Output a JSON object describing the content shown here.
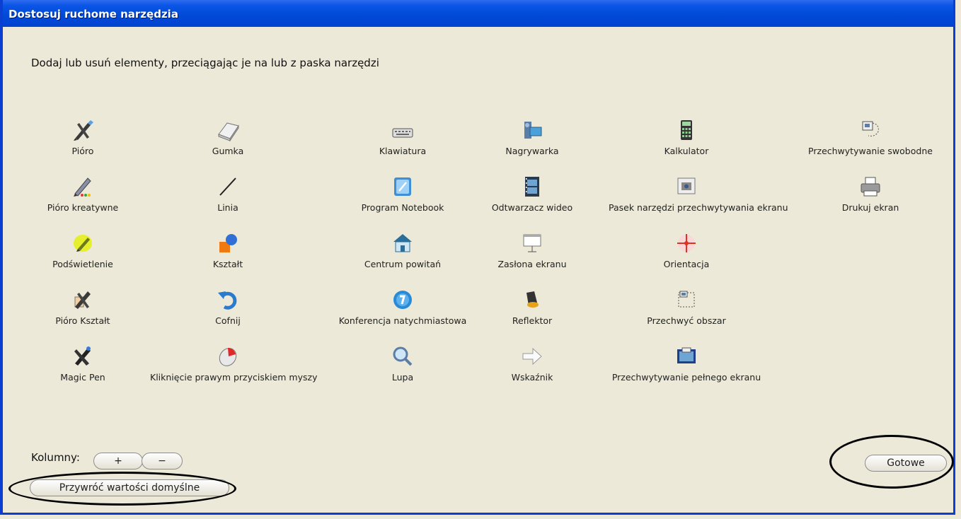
{
  "window": {
    "title": "Dostosuj ruchome narzędzia"
  },
  "instruction": "Dodaj lub usuń elementy, przeciągając je na lub z paska narzędzi",
  "tools": [
    {
      "label": "Pióro",
      "icon": "pen-icon"
    },
    {
      "label": "Gumka",
      "icon": "eraser-icon"
    },
    {
      "label": "Klawiatura",
      "icon": "keyboard-icon"
    },
    {
      "label": "Nagrywarka",
      "icon": "recorder-icon"
    },
    {
      "label": "Kalkulator",
      "icon": "calculator-icon"
    },
    {
      "label": "Przechwytywanie swobodne",
      "icon": "freehand-capture-icon"
    },
    {
      "label": "Pióro kreatywne",
      "icon": "creative-pen-icon"
    },
    {
      "label": "Linia",
      "icon": "line-icon"
    },
    {
      "label": "Program Notebook",
      "icon": "notebook-icon"
    },
    {
      "label": "Odtwarzacz wideo",
      "icon": "video-player-icon"
    },
    {
      "label": "Pasek narzędzi przechwytywania ekranu",
      "icon": "capture-toolbar-icon"
    },
    {
      "label": "Drukuj ekran",
      "icon": "print-icon"
    },
    {
      "label": "Podświetlenie",
      "icon": "highlighter-icon"
    },
    {
      "label": "Kształt",
      "icon": "shape-icon"
    },
    {
      "label": "Centrum powitań",
      "icon": "welcome-center-icon"
    },
    {
      "label": "Zasłona ekranu",
      "icon": "screen-shade-icon"
    },
    {
      "label": "Orientacja",
      "icon": "orientation-icon"
    },
    {
      "label": "Pióro Kształt",
      "icon": "shape-pen-icon"
    },
    {
      "label": "Cofnij",
      "icon": "undo-icon"
    },
    {
      "label": "Konferencja natychmiastowa",
      "icon": "instant-conference-icon"
    },
    {
      "label": "Reflektor",
      "icon": "spotlight-icon"
    },
    {
      "label": "Przechwyć obszar",
      "icon": "area-capture-icon"
    },
    {
      "label": "Magic Pen",
      "icon": "magic-pen-icon"
    },
    {
      "label": "Kliknięcie prawym przyciskiem myszy",
      "icon": "right-click-icon"
    },
    {
      "label": "Lupa",
      "icon": "magnifier-icon"
    },
    {
      "label": "Wskaźnik",
      "icon": "pointer-icon"
    },
    {
      "label": "Przechwytywanie pełnego ekranu",
      "icon": "fullscreen-capture-icon"
    }
  ],
  "columns": {
    "label": "Kolumny:",
    "plus": "+",
    "minus": "−"
  },
  "buttons": {
    "restore": "Przywróć wartości domyślne",
    "done": "Gotowe"
  },
  "colors": {
    "titlebar": "#0049d6",
    "dialog_bg": "#ece9d8",
    "annotation": "#000000"
  }
}
